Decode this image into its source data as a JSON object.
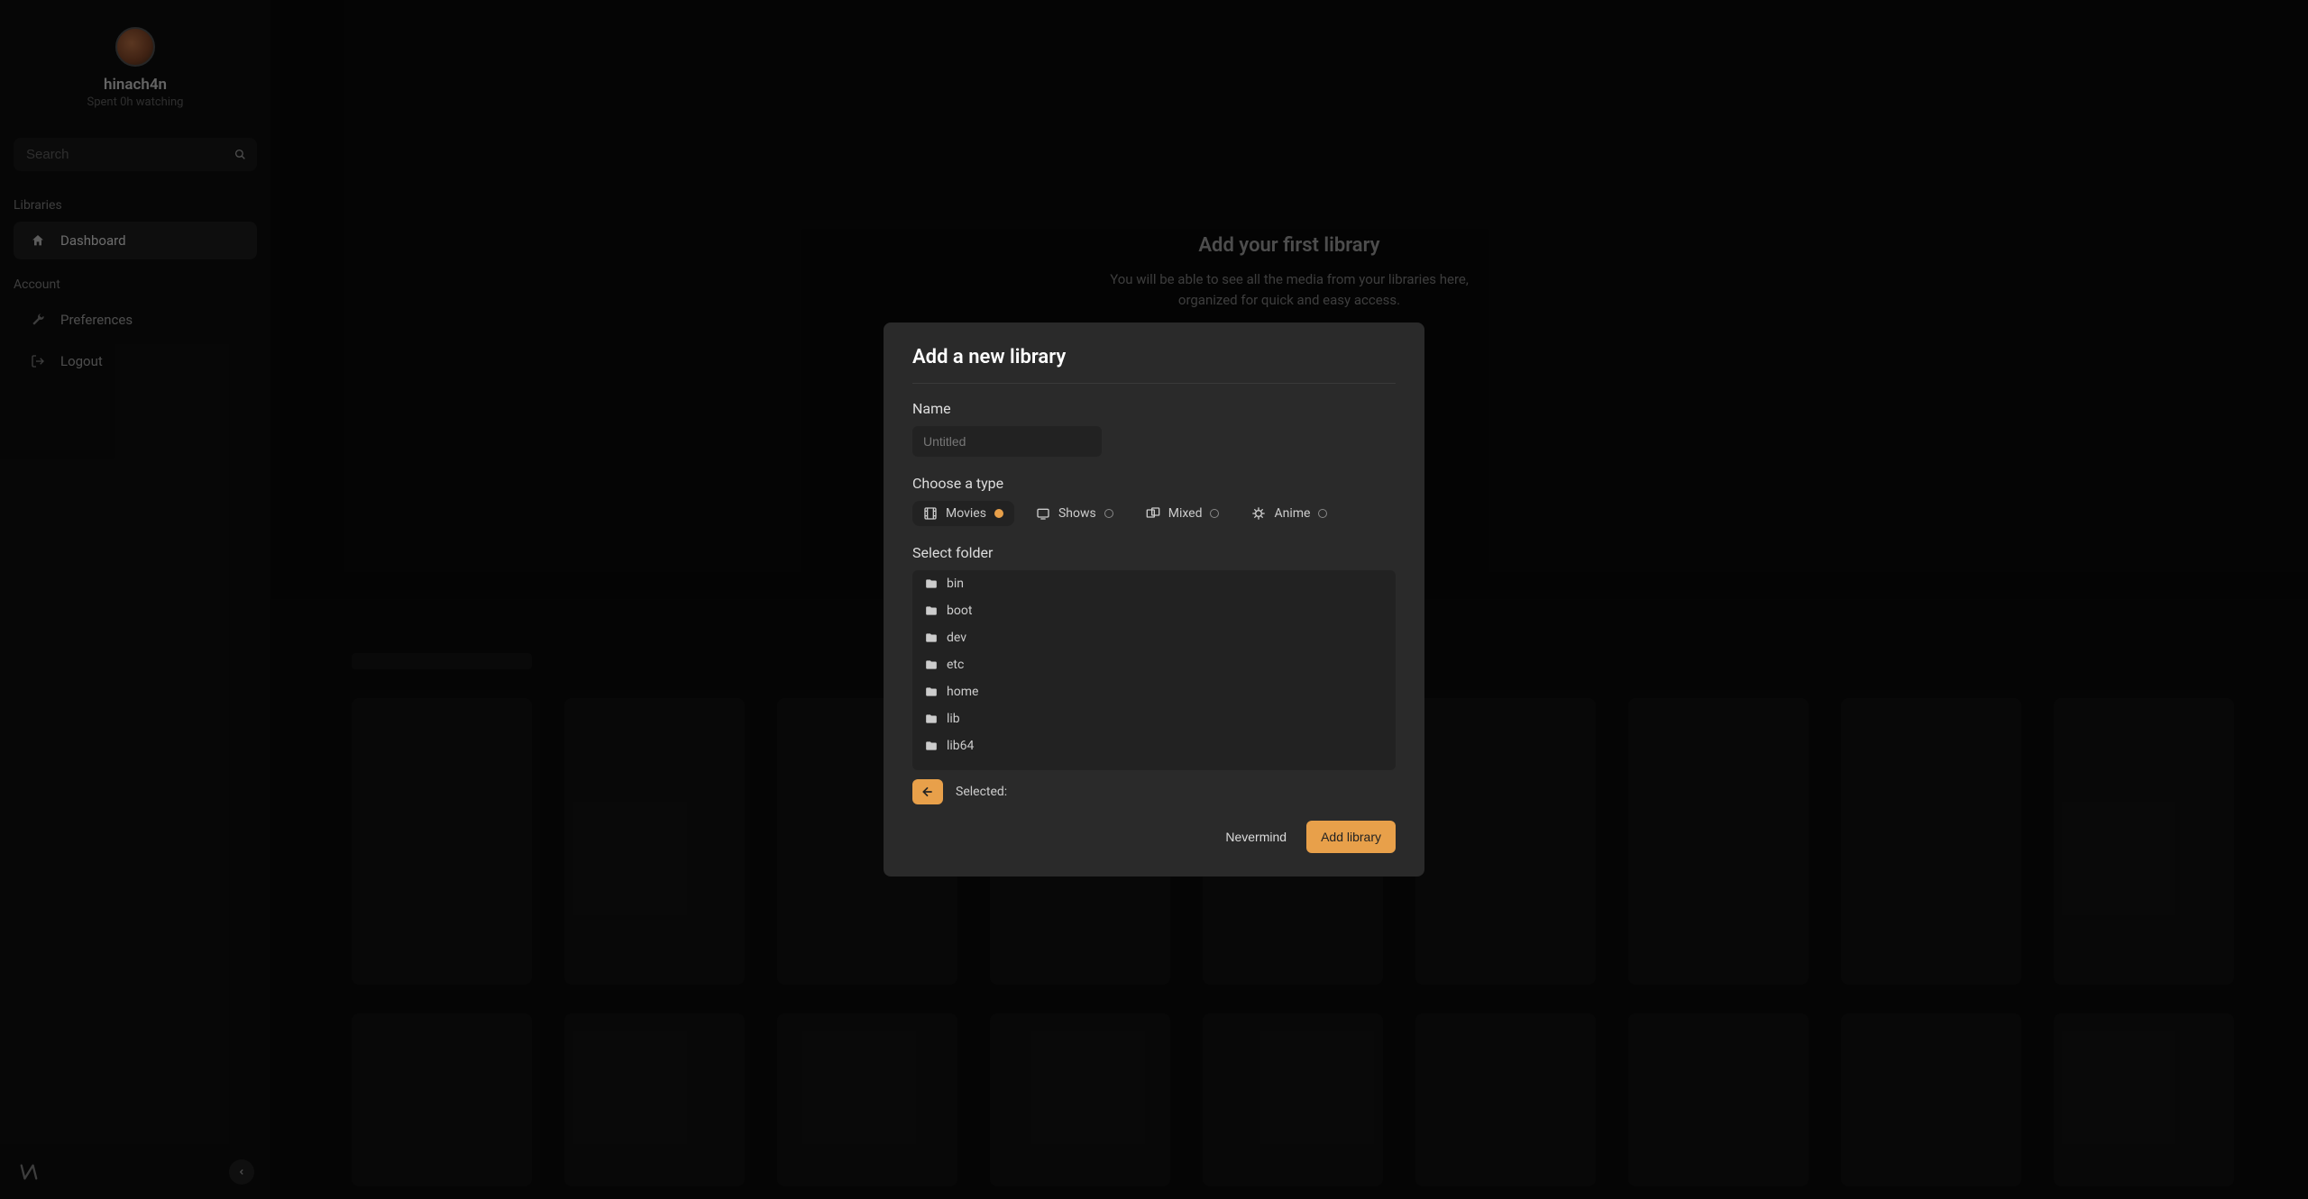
{
  "sidebar": {
    "username": "hinach4n",
    "user_subtitle": "Spent 0h watching",
    "search_placeholder": "Search",
    "libraries_label": "Libraries",
    "dashboard_label": "Dashboard",
    "account_label": "Account",
    "preferences_label": "Preferences",
    "logout_label": "Logout"
  },
  "empty_state": {
    "title": "Add your first library",
    "subtitle": "You will be able to see all the media from your libraries here, organized for quick and easy access."
  },
  "modal": {
    "title": "Add a new library",
    "name_label": "Name",
    "name_placeholder": "Untitled",
    "type_label": "Choose a type",
    "types": [
      {
        "label": "Movies",
        "selected": true
      },
      {
        "label": "Shows",
        "selected": false
      },
      {
        "label": "Mixed",
        "selected": false
      },
      {
        "label": "Anime",
        "selected": false
      }
    ],
    "folder_label": "Select folder",
    "folders": [
      "bin",
      "boot",
      "dev",
      "etc",
      "home",
      "lib",
      "lib64"
    ],
    "selected_label": "Selected:",
    "cancel_label": "Nevermind",
    "confirm_label": "Add library"
  },
  "colors": {
    "accent": "#e8a04a"
  }
}
